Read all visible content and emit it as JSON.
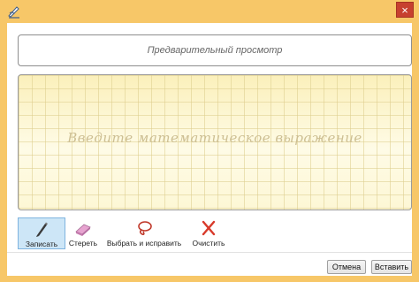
{
  "window": {
    "app_icon": "math-input-pen-icon",
    "close_icon": "close-icon",
    "close_glyph": "×"
  },
  "preview": {
    "text": "Предварительный просмотр"
  },
  "pad": {
    "hint": "Введите математическое выражение"
  },
  "toolbar": {
    "tools": [
      {
        "label": "Записать",
        "icon": "pen-icon",
        "active": true
      },
      {
        "label": "Стереть",
        "icon": "eraser-icon",
        "active": false
      },
      {
        "label": "Выбрать и исправить",
        "icon": "lasso-select-icon",
        "active": false
      },
      {
        "label": "Очистить",
        "icon": "clear-x-icon",
        "active": false
      }
    ]
  },
  "buttons": {
    "cancel": "Отмена",
    "insert": "Вставить"
  },
  "colors": {
    "titlebar": "#f7c768",
    "close": "#c7402f",
    "pad_background": "#fdf7cf",
    "active_tool": "#cde6f7"
  }
}
